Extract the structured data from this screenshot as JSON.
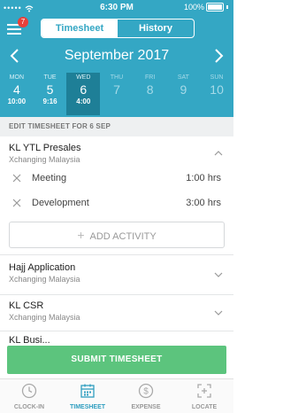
{
  "status": {
    "signal": "•••••",
    "wifi": "wifi-icon",
    "time": "6:30 PM",
    "battery": "100%"
  },
  "header": {
    "menu_badge": "7",
    "tabs": [
      {
        "label": "Timesheet",
        "active": true
      },
      {
        "label": "History",
        "active": false
      }
    ],
    "month": "September 2017"
  },
  "days": [
    {
      "name": "MON",
      "num": "4",
      "hrs": "10:00"
    },
    {
      "name": "TUE",
      "num": "5",
      "hrs": "9:16"
    },
    {
      "name": "WED",
      "num": "6",
      "hrs": "4:00"
    },
    {
      "name": "THU",
      "num": "7",
      "hrs": ""
    },
    {
      "name": "FRI",
      "num": "8",
      "hrs": ""
    },
    {
      "name": "SAT",
      "num": "9",
      "hrs": ""
    },
    {
      "name": "SUN",
      "num": "10",
      "hrs": ""
    }
  ],
  "section_label": "EDIT TIMESHEET FOR 6 SEP",
  "projects": [
    {
      "name": "KL YTL Presales",
      "company": "Xchanging Malaysia"
    },
    {
      "name": "Hajj Application",
      "company": "Xchanging Malaysia"
    },
    {
      "name": "KL CSR",
      "company": "Xchanging Malaysia"
    },
    {
      "name": "KL Busi...",
      "company": ""
    }
  ],
  "activities": [
    {
      "name": "Meeting",
      "hours": "1:00 hrs"
    },
    {
      "name": "Development",
      "hours": "3:00 hrs"
    }
  ],
  "add_activity": "ADD ACTIVITY",
  "submit": "SUBMIT TIMESHEET",
  "tabbar": [
    {
      "label": "CLOCK-IN",
      "icon": "clock-icon",
      "active": false
    },
    {
      "label": "TIMESHEET",
      "icon": "calendar-icon",
      "active": true
    },
    {
      "label": "EXPENSE",
      "icon": "dollar-icon",
      "active": false
    },
    {
      "label": "LOCATE",
      "icon": "locate-icon",
      "active": false
    }
  ],
  "colors": {
    "header": "#34a7c4",
    "selected_day": "#1e7f97",
    "submit": "#5cc47d",
    "badge": "#e8403a",
    "active_tab": "#2f9ec0"
  }
}
